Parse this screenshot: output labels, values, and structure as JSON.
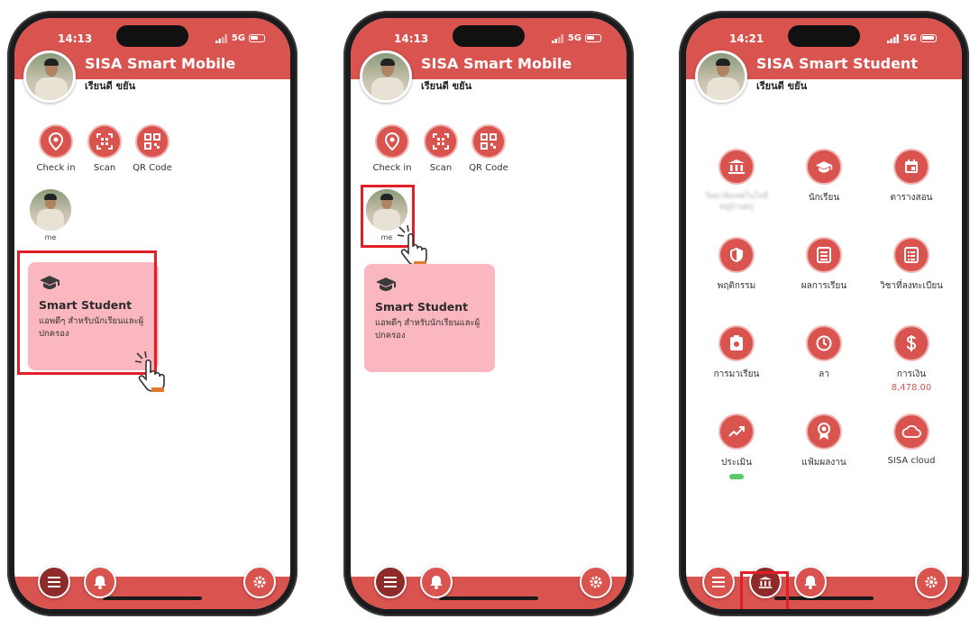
{
  "colors": {
    "primary": "#d9534f",
    "card": "#fbb7bf",
    "highlight": "#e01f26",
    "money": "#d9534f"
  },
  "phones": [
    {
      "time": "14:13",
      "network": "5G",
      "app_title": "SISA Smart Mobile",
      "user_name": "เรียนดี ขยัน",
      "quick_actions": [
        {
          "label": "Check in",
          "icon": "location-pin-icon"
        },
        {
          "label": "Scan",
          "icon": "scan-icon"
        },
        {
          "label": "QR Code",
          "icon": "qr-code-icon"
        }
      ],
      "me_label": "me",
      "card": {
        "title": "Smart Student",
        "subtitle": "แอพดีๆ สำหรับนักเรียนและผู้ปกครอง",
        "icon": "graduation-cap-icon"
      }
    },
    {
      "time": "14:13",
      "network": "5G",
      "app_title": "SISA Smart Mobile",
      "user_name": "เรียนดี ขยัน",
      "quick_actions": [
        {
          "label": "Check in",
          "icon": "location-pin-icon"
        },
        {
          "label": "Scan",
          "icon": "scan-icon"
        },
        {
          "label": "QR Code",
          "icon": "qr-code-icon"
        }
      ],
      "me_label": "me",
      "card": {
        "title": "Smart Student",
        "subtitle": "แอพดีๆ สำหรับนักเรียนและผู้ปกครอง",
        "icon": "graduation-cap-icon"
      }
    },
    {
      "time": "14:21",
      "network": "5G",
      "app_title": "SISA Smart Student",
      "user_name": "เรียนดี ขยัน",
      "menu": [
        {
          "label": "วิทยาลัยเทคโนโลยีหมู่บ้านครู",
          "icon": "bank-icon",
          "blurred": true
        },
        {
          "label": "นักเรียน",
          "icon": "graduation-cap-icon"
        },
        {
          "label": "ตารางสอน",
          "icon": "calendar-icon"
        },
        {
          "label": "พฤติกรรม",
          "icon": "shield-icon"
        },
        {
          "label": "ผลการเรียน",
          "icon": "list-icon"
        },
        {
          "label": "วิชาที่ลงทะเบียน",
          "icon": "register-list-icon"
        },
        {
          "label": "การมาเรียน",
          "icon": "attendance-icon"
        },
        {
          "label": "ลา",
          "icon": "clock-icon"
        },
        {
          "label": "การเงิน",
          "icon": "dollar-icon",
          "value": "8,478.00"
        },
        {
          "label": "ประเมิน",
          "icon": "trend-icon"
        },
        {
          "label": "แฟ้มผลงาน",
          "icon": "award-icon"
        },
        {
          "label": "SISA cloud",
          "icon": "cloud-icon"
        }
      ]
    }
  ]
}
